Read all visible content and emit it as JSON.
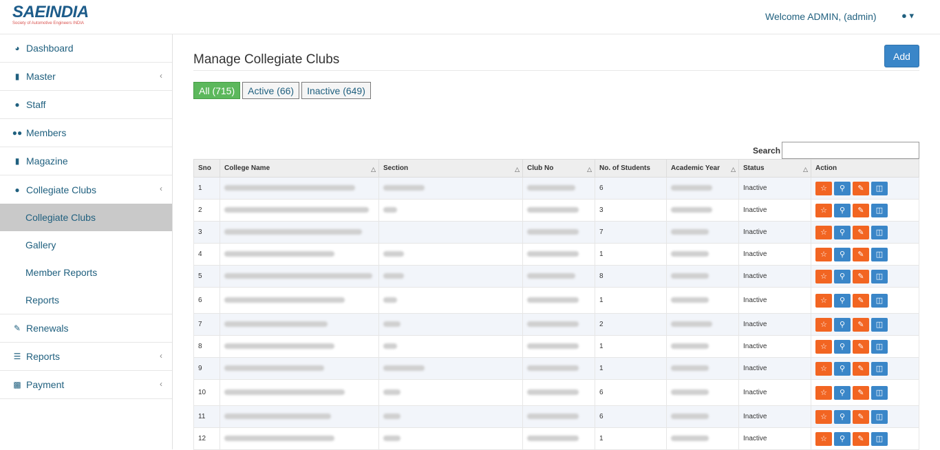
{
  "header": {
    "logo_main": "SAEINDIA",
    "logo_sub": "Society of Automotive Engineers INDIA",
    "welcome": "Welcome ADMIN, (admin)",
    "user_icon": "user-icon"
  },
  "sidebar": {
    "items": [
      {
        "label": "Dashboard",
        "icon": "dashboard-icon",
        "chevron": false
      },
      {
        "label": "Master",
        "icon": "file-icon",
        "chevron": true
      },
      {
        "label": "Staff",
        "icon": "user-icon",
        "chevron": false
      },
      {
        "label": "Members",
        "icon": "users-icon",
        "chevron": false
      },
      {
        "label": "Magazine",
        "icon": "file-icon",
        "chevron": false
      },
      {
        "label": "Collegiate Clubs",
        "icon": "user-icon",
        "chevron": true
      }
    ],
    "sub_items": [
      "Collegiate Clubs",
      "Gallery",
      "Member Reports",
      "Reports"
    ],
    "after_items": [
      {
        "label": "Renewals",
        "icon": "edit-icon",
        "chevron": false
      },
      {
        "label": "Reports",
        "icon": "list-icon",
        "chevron": true
      },
      {
        "label": "Payment",
        "icon": "money-icon",
        "chevron": true
      }
    ]
  },
  "main": {
    "title": "Manage Collegiate Clubs",
    "add_label": "Add",
    "filters": [
      "All (715)",
      "Active (66)",
      "Inactive (649)"
    ],
    "search_label": "Search",
    "columns": [
      "Sno",
      "College Name",
      "Section",
      "Club No",
      "No. of Students",
      "Academic Year",
      "Status",
      "Action"
    ],
    "rows": [
      {
        "sno": "1",
        "students": "6",
        "status": "Inactive"
      },
      {
        "sno": "2",
        "students": "3",
        "status": "Inactive"
      },
      {
        "sno": "3",
        "students": "7",
        "status": "Inactive"
      },
      {
        "sno": "4",
        "students": "1",
        "status": "Inactive"
      },
      {
        "sno": "5",
        "students": "8",
        "status": "Inactive"
      },
      {
        "sno": "6",
        "students": "1",
        "status": "Inactive"
      },
      {
        "sno": "7",
        "students": "2",
        "status": "Inactive"
      },
      {
        "sno": "8",
        "students": "1",
        "status": "Inactive"
      },
      {
        "sno": "9",
        "students": "1",
        "status": "Inactive"
      },
      {
        "sno": "10",
        "students": "6",
        "status": "Inactive"
      },
      {
        "sno": "11",
        "students": "6",
        "status": "Inactive"
      },
      {
        "sno": "12",
        "students": "1",
        "status": "Inactive"
      }
    ]
  },
  "colors": {
    "accent": "#20607f",
    "active_filter": "#5cb85c",
    "add_button": "#3a86c8",
    "action_orange": "#f26522",
    "action_blue": "#3a86c8"
  }
}
